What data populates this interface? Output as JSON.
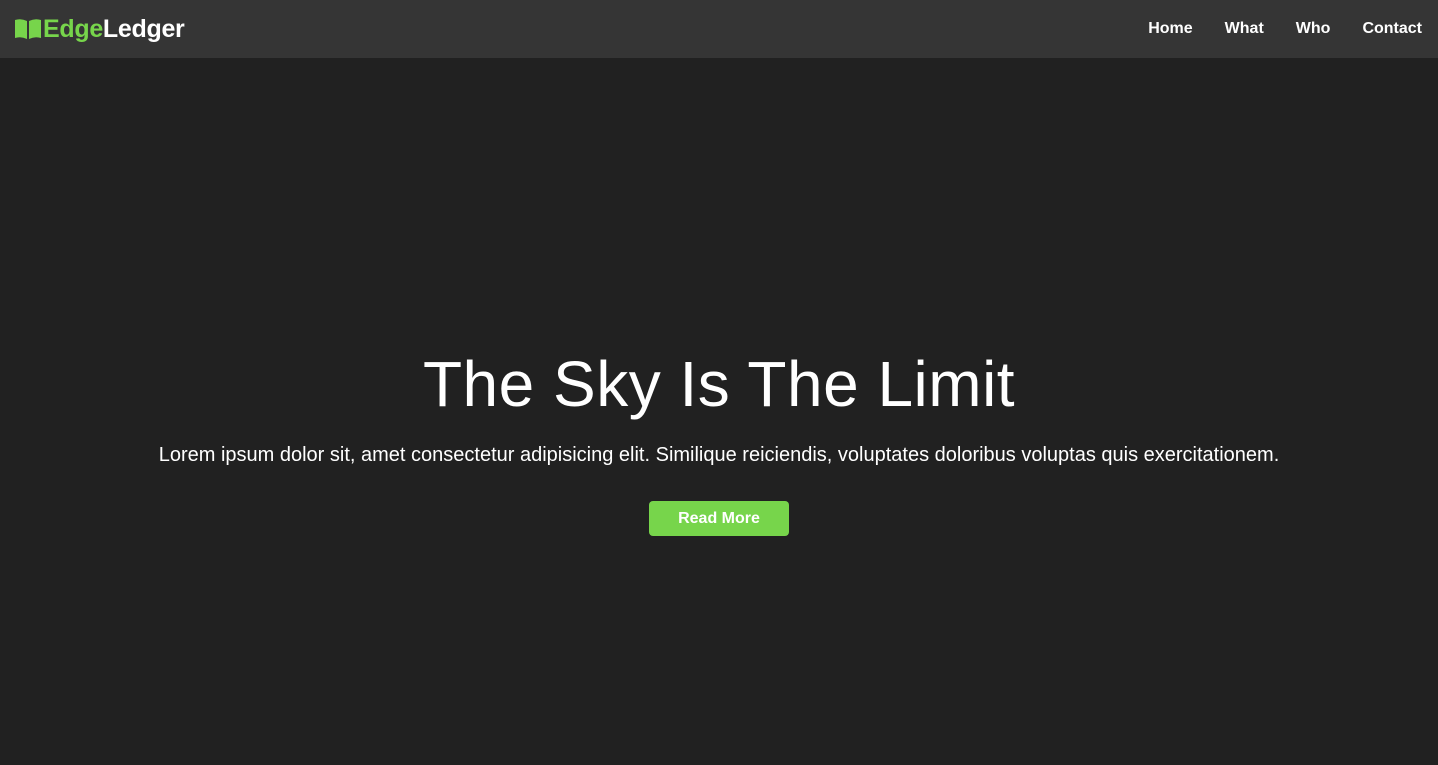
{
  "navbar": {
    "brand": {
      "icon": "open-book-icon",
      "accent_text": "Edge",
      "main_text": "Ledger"
    },
    "links": [
      {
        "label": "Home"
      },
      {
        "label": "What"
      },
      {
        "label": "Who"
      },
      {
        "label": "Contact"
      }
    ]
  },
  "hero": {
    "title": "The Sky Is The Limit",
    "text": "Lorem ipsum dolor sit, amet consectetur adipisicing elit. Similique reiciendis, voluptates doloribus voluptas quis exercitationem.",
    "button_label": "Read More"
  },
  "colors": {
    "accent": "#77d54b",
    "navbar_bg": "#353535",
    "page_bg": "#212121",
    "text": "#ffffff"
  }
}
